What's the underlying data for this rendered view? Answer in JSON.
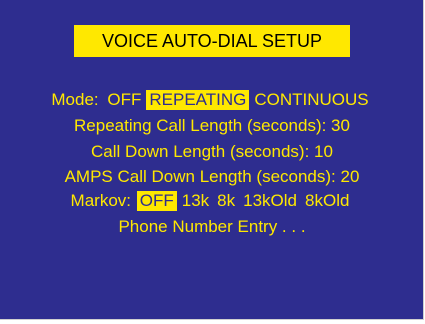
{
  "title": "VOICE AUTO-DIAL SETUP",
  "colors": {
    "background": "#2e2d8f",
    "text": "#ffe800",
    "highlight": "#ffe800"
  },
  "mode": {
    "label": "Mode:",
    "options": [
      "OFF",
      "REPEATING",
      "CONTINUOUS"
    ],
    "selected": "REPEATING"
  },
  "repeating_call_length": "Repeating Call Length (seconds): 30",
  "call_down_length": "Call Down Length (seconds): 10",
  "amps_call_down_length": "AMPS Call Down Length (seconds): 20",
  "markov": {
    "label": "Markov:",
    "options": [
      "OFF",
      "13k",
      "8k",
      "13kOld",
      "8kOld"
    ],
    "selected": "OFF"
  },
  "phone_number_entry": "Phone Number Entry . . ."
}
